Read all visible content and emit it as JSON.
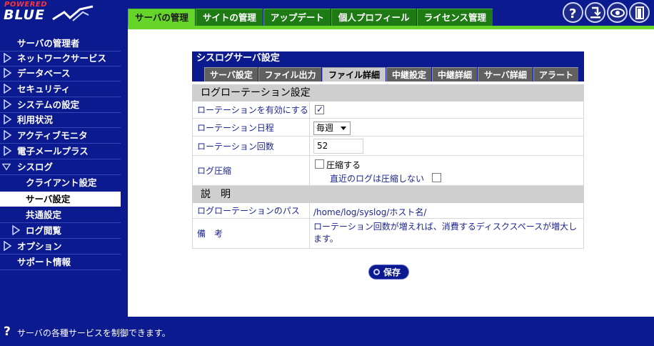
{
  "header": {
    "logo_powered": "POWERED",
    "logo_blue": "BLUE",
    "tabs": [
      {
        "label": "サーバの管理",
        "active": true
      },
      {
        "label": "サイトの管理"
      },
      {
        "label": "アップデート"
      },
      {
        "label": "個人プロフィール"
      },
      {
        "label": "ライセンス管理"
      }
    ],
    "icons": [
      "help-icon",
      "download-icon",
      "eye-icon",
      "logout-icon"
    ]
  },
  "sidebar": {
    "items": [
      {
        "label": "サーバの管理者",
        "arrow": "none"
      },
      {
        "label": "ネットワークサービス",
        "arrow": "right"
      },
      {
        "label": "データベース",
        "arrow": "right"
      },
      {
        "label": "セキュリティ",
        "arrow": "right"
      },
      {
        "label": "システムの設定",
        "arrow": "right"
      },
      {
        "label": "利用状況",
        "arrow": "right"
      },
      {
        "label": "アクティブモニタ",
        "arrow": "right"
      },
      {
        "label": "電子メールプラス",
        "arrow": "right"
      },
      {
        "label": "シスログ",
        "arrow": "down"
      },
      {
        "label": "クライアント設定",
        "arrow": "none",
        "indent": 1
      },
      {
        "label": "サーバ設定",
        "arrow": "none",
        "indent": 1,
        "selected": true
      },
      {
        "label": "共通設定",
        "arrow": "none",
        "indent": 1
      },
      {
        "label": "ログ閲覧",
        "arrow": "right",
        "indent": 1
      },
      {
        "label": "オプション",
        "arrow": "right"
      },
      {
        "label": "サポート情報",
        "arrow": "none"
      }
    ]
  },
  "panel": {
    "title": "シスログサーバ設定",
    "subtabs": [
      {
        "label": "サーバ設定"
      },
      {
        "label": "ファイル出力"
      },
      {
        "label": "ファイル詳細",
        "active": true
      },
      {
        "label": "中継設定"
      },
      {
        "label": "中継詳細"
      },
      {
        "label": "サーバ詳細"
      },
      {
        "label": "アラート"
      }
    ],
    "section1": "ログローテーション設定",
    "rotate_enable_label": "ローテーションを有効にする",
    "rotate_enabled": true,
    "rotate_schedule_label": "ローテーション日程",
    "rotate_schedule_value": "毎週",
    "rotate_count_label": "ローテーション回数",
    "rotate_count_value": "52",
    "compress_label": "ログ圧縮",
    "compress_option": "圧縮する",
    "compress_checked": false,
    "compress_recent_option": "直近のログは圧縮しない",
    "compress_recent_checked": false,
    "section2": "説　明",
    "path_label": "ログローテーションのパス",
    "path_value": "/home/log/syslog/ホスト名/",
    "note_label": "備　考",
    "note_value": "ローテーション回数が増えれば、消費するディスクスペースが増大します。"
  },
  "save_label": "保存",
  "footer": {
    "message": "サーバの各種サービスを制御できます。"
  },
  "colors": {
    "navy": "#0b1a8f",
    "tab_green": "#1e7a14",
    "tab_active": "#66d52a",
    "label_blue": "#1d2690"
  }
}
